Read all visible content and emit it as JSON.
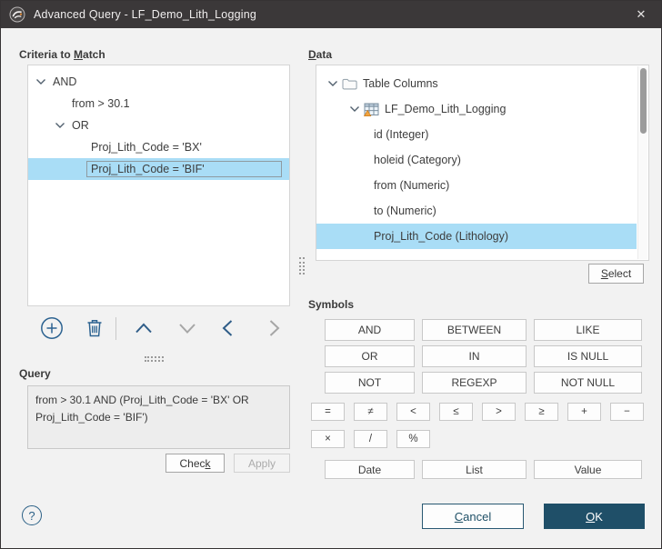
{
  "window": {
    "title": "Advanced Query - LF_Demo_Lith_Logging",
    "close_glyph": "✕"
  },
  "colors": {
    "titlebar": "#3b3839",
    "body": "#f2f2f2",
    "selection": "#a9ddf6",
    "accent_blue": "#2d6391",
    "ok_button": "#1f4f68"
  },
  "criteria": {
    "label": {
      "pre": "Criteria to ",
      "key": "M",
      "post": "atch"
    },
    "rows": [
      {
        "label": "AND"
      },
      {
        "label": "from > 30.1"
      },
      {
        "label": "OR"
      },
      {
        "label": "Proj_Lith_Code = 'BX'"
      },
      {
        "label": "Proj_Lith_Code = 'BIF'"
      }
    ]
  },
  "toolbar": {
    "icons": [
      "add-criterion",
      "delete-criterion",
      "move-up",
      "move-down",
      "move-left",
      "move-right"
    ]
  },
  "query": {
    "label": "Query",
    "text": "from > 30.1 AND (Proj_Lith_Code = 'BX' OR Proj_Lith_Code = 'BIF')",
    "check": {
      "pre": "Chec",
      "key": "k",
      "post": ""
    },
    "apply": "Apply"
  },
  "data": {
    "label": {
      "pre": "",
      "key": "D",
      "post": "ata"
    },
    "rows": [
      {
        "label": "Table Columns"
      },
      {
        "label": "LF_Demo_Lith_Logging"
      },
      {
        "label": "id (Integer)"
      },
      {
        "label": "holeid (Category)"
      },
      {
        "label": "from (Numeric)"
      },
      {
        "label": "to (Numeric)"
      },
      {
        "label": "Proj_Lith_Code (Lithology)"
      }
    ],
    "select": {
      "pre": "",
      "key": "S",
      "post": "elect"
    }
  },
  "symbols": {
    "label": "Symbols",
    "keywords": [
      "AND",
      "BETWEEN",
      "LIKE",
      "OR",
      "IN",
      "IS NULL",
      "NOT",
      "REGEXP",
      "NOT NULL"
    ],
    "operators": [
      "=",
      "≠",
      "<",
      "≤",
      ">",
      "≥",
      "+",
      "−",
      "×",
      "/",
      "%"
    ],
    "value_buttons": [
      "Date",
      "List",
      "Value"
    ]
  },
  "footer": {
    "help_glyph": "?",
    "cancel": {
      "pre": "",
      "key": "C",
      "post": "ancel"
    },
    "ok": {
      "pre": "",
      "key": "O",
      "post": "K"
    }
  }
}
